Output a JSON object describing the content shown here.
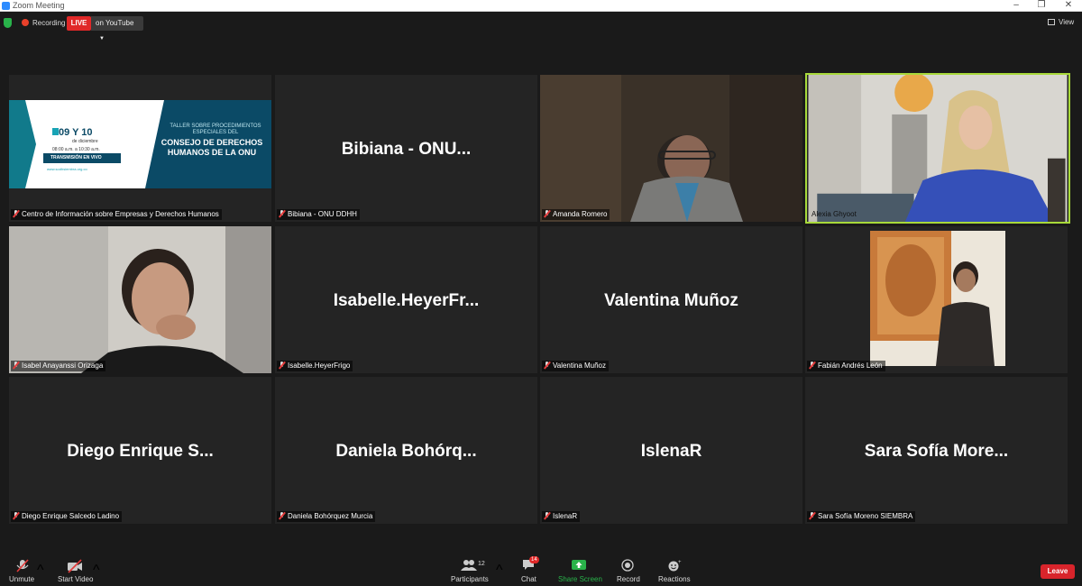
{
  "window": {
    "title": "Zoom Meeting"
  },
  "top_bar": {
    "recording_label": "Recording",
    "live_label": "LIVE",
    "stream_target": "on YouTube",
    "view_label": "View"
  },
  "slide": {
    "date": "09 Y 10",
    "month": "de diciembre",
    "hours": "08:00 a.m. a 10:30 a.m.",
    "broadcast": "TRANSMISIÓN EN VIVO",
    "url": "www.sodhsiembra.org.co",
    "title_small": "TALLER SOBRE PROCEDIMIENTOS ESPECIALES DEL",
    "title_big": "CONSEJO DE DERECHOS HUMANOS DE LA ONU"
  },
  "participants": [
    {
      "display": "",
      "label": "Centro de Información sobre Empresas y Derechos Humanos"
    },
    {
      "display": "Bibiana - ONU...",
      "label": "Bibiana - ONU DDHH"
    },
    {
      "display": "",
      "label": "Amanda Romero"
    },
    {
      "display": "",
      "label": "Alexia Ghyoot"
    },
    {
      "display": "",
      "label": "Isabel Anayanssi Orizaga"
    },
    {
      "display": "Isabelle.HeyerFr...",
      "label": "Isabelle.HeyerFrigo"
    },
    {
      "display": "Valentina Muñoz",
      "label": "Valentina Muñoz"
    },
    {
      "display": "",
      "label": "Fabián Andrés León"
    },
    {
      "display": "Diego Enrique S...",
      "label": "Diego Enrique Salcedo Ladino"
    },
    {
      "display": "Daniela Bohórq...",
      "label": "Daniela Bohórquez Murcia"
    },
    {
      "display": "IslenaR",
      "label": "IslenaR"
    },
    {
      "display": "Sara Sofía More...",
      "label": "Sara Sofía Moreno SIEMBRA"
    }
  ],
  "toolbar": {
    "unmute": "Unmute",
    "start_video": "Start Video",
    "participants": "Participants",
    "participants_count": "12",
    "chat": "Chat",
    "chat_badge": "14",
    "share_screen": "Share Screen",
    "record": "Record",
    "reactions": "Reactions",
    "leave": "Leave"
  },
  "colors": {
    "active_speaker": "#a8d93a",
    "live": "#e02828",
    "share": "#29b34a",
    "leave": "#d8242b"
  }
}
